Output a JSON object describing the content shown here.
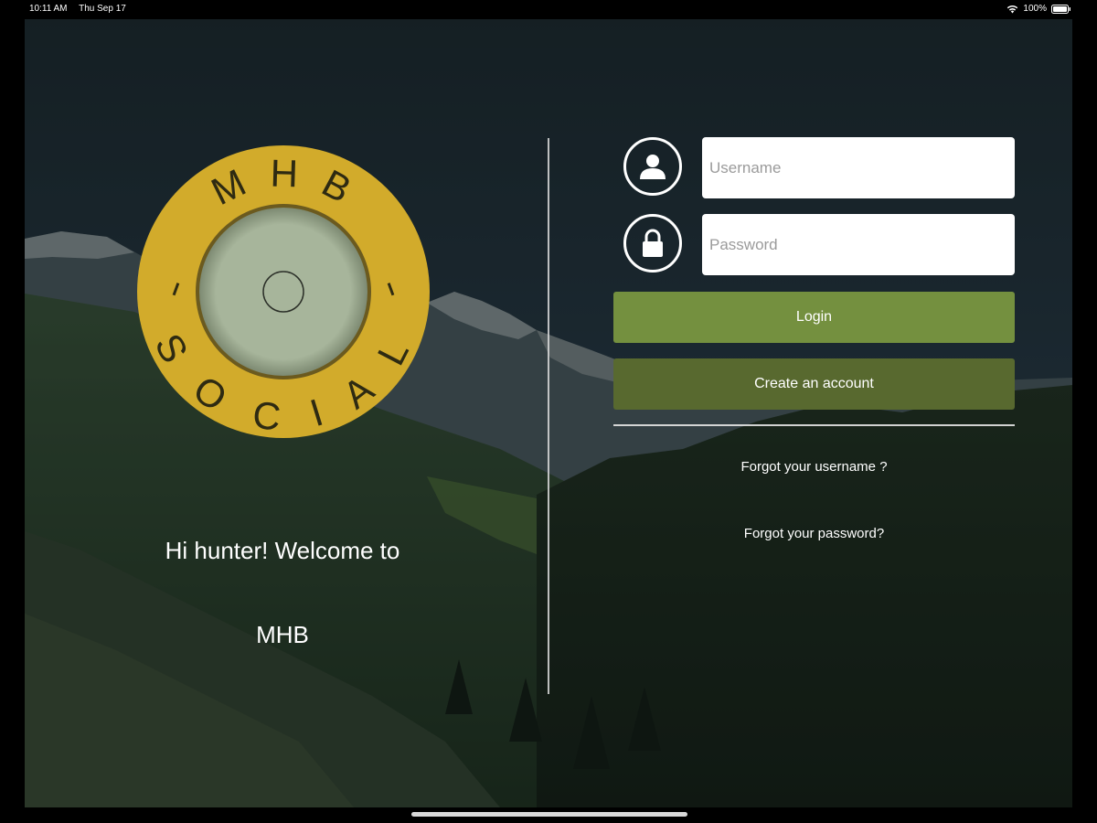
{
  "status_bar": {
    "time": "10:11 AM",
    "date": "Thu Sep 17",
    "battery": "100%",
    "icons": [
      "wifi-icon",
      "battery-icon"
    ]
  },
  "logo": {
    "top_text": "M H B",
    "bottom_text": "S O C I A L",
    "ring_color": "#d2ab2b",
    "center_color": "#a7b59b"
  },
  "welcome": {
    "greeting": "Hi hunter! Welcome to",
    "app_name": "MHB"
  },
  "login_form": {
    "username_placeholder": "Username",
    "password_placeholder": "Password",
    "login_label": "Login",
    "create_account_label": "Create an account",
    "forgot_username_label": "Forgot your username ?",
    "forgot_password_label": "Forgot your password?",
    "icons": [
      "user-icon",
      "lock-icon"
    ]
  },
  "colors": {
    "login_button": "#74903f",
    "create_button": "#58692f"
  }
}
